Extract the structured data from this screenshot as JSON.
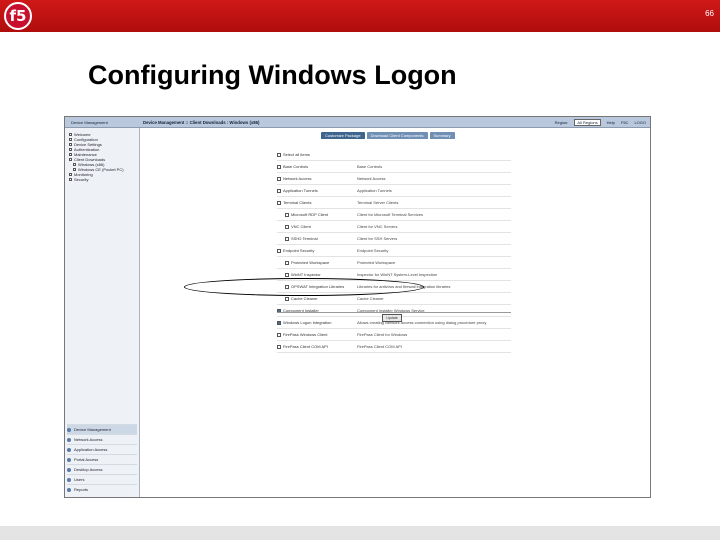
{
  "slide": {
    "logo_text": "f5",
    "number": "66",
    "title": "Configuring Windows Logon"
  },
  "app": {
    "header_left": "Device Management",
    "breadcrumb": "Device Management :: Client Downloads : Windows (x86)",
    "region_label": "Region:",
    "region_value": "All Regions",
    "header_links": [
      "Help",
      "F5C",
      "LOGO"
    ]
  },
  "sidebar": {
    "tree": [
      "Welcome",
      "Configuration",
      "Device Settings",
      "Authentication",
      "Maintenance",
      "Client Downloads",
      "Windows (x86)",
      "Windows CE (Pocket PC)",
      "Monitoring",
      "Security"
    ],
    "nav": [
      "Device Management",
      "Network Access",
      "Application Access",
      "Portal Access",
      "Desktop Access",
      "Users",
      "Reports"
    ]
  },
  "tabs": [
    "Customize Package",
    "Download Client Components",
    "Summary"
  ],
  "components": [
    {
      "label": "Select all items",
      "desc": "",
      "checked": false,
      "indent": false
    },
    {
      "label": "Base Controls",
      "desc": "Base Controls",
      "checked": false,
      "indent": false
    },
    {
      "label": "Network Access",
      "desc": "Network Access",
      "checked": false,
      "indent": false
    },
    {
      "label": "Application Tunnels",
      "desc": "Application Tunnels",
      "checked": false,
      "indent": false
    },
    {
      "label": "Terminal Clients",
      "desc": "Terminal Server Clients",
      "checked": false,
      "indent": false
    },
    {
      "label": "Microsoft RDP Client",
      "desc": "Client for Microsoft Terminal Services",
      "checked": false,
      "indent": true
    },
    {
      "label": "VNC Client",
      "desc": "Client for VNC Servers",
      "checked": false,
      "indent": true
    },
    {
      "label": "SSH2 Terminal",
      "desc": "Client for SSH Servers",
      "checked": false,
      "indent": true
    },
    {
      "label": "Endpoint Security",
      "desc": "Endpoint Security",
      "checked": false,
      "indent": false
    },
    {
      "label": "Protected Workspace",
      "desc": "Protected Workspace",
      "checked": false,
      "indent": true
    },
    {
      "label": "WinNT Inspector",
      "desc": "Inspector for WinNT System-Level Inspection",
      "checked": false,
      "indent": true
    },
    {
      "label": "OPSWAT Integration Libraries",
      "desc": "Libraries for antivirus and firewall integration libraries",
      "checked": false,
      "indent": true
    },
    {
      "label": "Cache Cleaner",
      "desc": "Cache Cleaner",
      "checked": false,
      "indent": true
    },
    {
      "label": "Component Installer",
      "desc": "Component Installer Windows Service",
      "checked": true,
      "indent": false
    },
    {
      "label": "Windows Logon Integration",
      "desc": "Allows creating Network Access connection using dialog procedure proxy",
      "checked": true,
      "indent": false
    },
    {
      "label": "FirePass Windows Client",
      "desc": "FirePass Client for Windows",
      "checked": false,
      "indent": false
    },
    {
      "label": "FirePass Client COM API",
      "desc": "FirePass Client COM API",
      "checked": false,
      "indent": false
    }
  ],
  "update_label": "Update"
}
